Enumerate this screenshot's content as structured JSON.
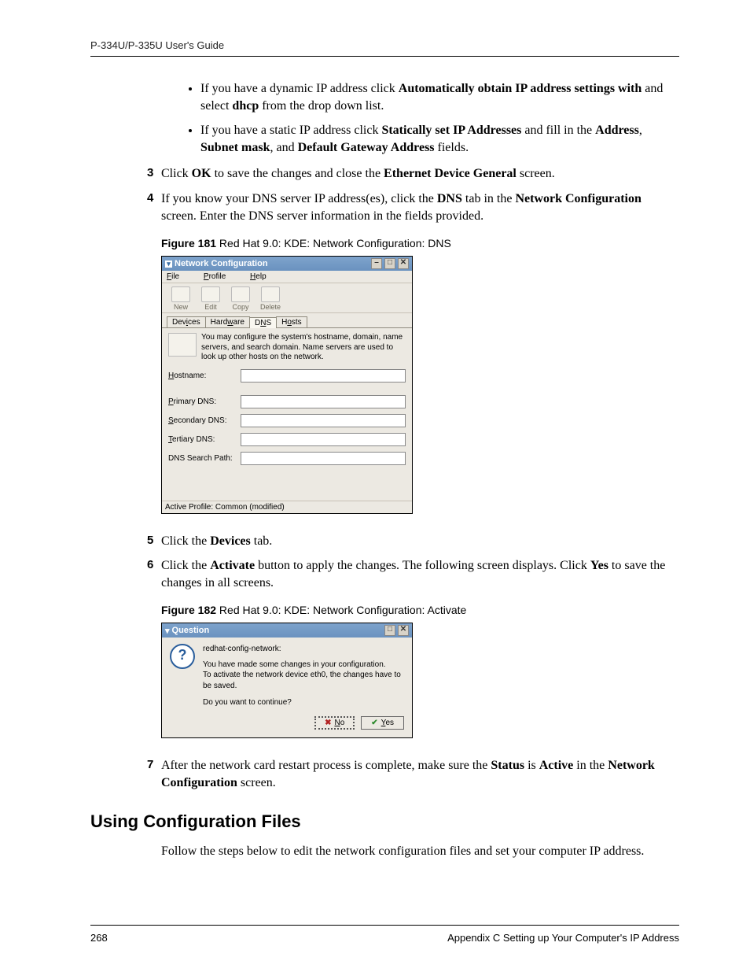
{
  "header": {
    "guide_title": "P-334U/P-335U User's Guide"
  },
  "bullets": {
    "b1_pre": "If you have a dynamic IP address click ",
    "b1_bold1": "Automatically obtain IP address settings with",
    "b1_mid": " and select ",
    "b1_bold2": "dhcp",
    "b1_post": " from the drop down list.",
    "b2_pre": "If you have a static IP address click ",
    "b2_bold1": "Statically set IP Addresses",
    "b2_mid1": " and fill in the  ",
    "b2_bold2": "Address",
    "b2_c1": ", ",
    "b2_bold3": "Subnet mask",
    "b2_c2": ", and ",
    "b2_bold4": "Default Gateway Address",
    "b2_post": " fields."
  },
  "steps": {
    "s3_num": "3",
    "s3_pre": "Click ",
    "s3_bold1": "OK",
    "s3_mid": " to save the changes and close the ",
    "s3_bold2": "Ethernet Device General",
    "s3_post": " screen.",
    "s4_num": "4",
    "s4_pre": "If you know your DNS server IP address(es), click the ",
    "s4_bold1": "DNS",
    "s4_mid": " tab in the ",
    "s4_bold2": "Network Configuration",
    "s4_post": " screen. Enter the DNS server information in the fields provided.",
    "s5_num": "5",
    "s5_pre": "Click the ",
    "s5_bold1": "Devices",
    "s5_post": " tab.",
    "s6_num": "6",
    "s6_pre": "Click the ",
    "s6_bold1": "Activate",
    "s6_mid": " button to apply the changes. The following screen displays. Click ",
    "s6_bold2": "Yes",
    "s6_post": " to save the changes in all screens.",
    "s7_num": "7",
    "s7_pre": "After the network card restart process is complete, make sure the ",
    "s7_bold1": "Status",
    "s7_mid": " is ",
    "s7_bold2": "Active",
    "s7_mid2": " in the ",
    "s7_bold3": "Network Configuration",
    "s7_post": " screen."
  },
  "fig181": {
    "label": "Figure 181",
    "caption": "   Red Hat 9.0: KDE: Network Configuration: DNS",
    "window_title": "Network Configuration",
    "menu": {
      "file": "File",
      "profile": "Profile",
      "help": "Help"
    },
    "toolbar": {
      "new": "New",
      "edit": "Edit",
      "copy": "Copy",
      "delete": "Delete"
    },
    "tabs": {
      "devices": "Devices",
      "hardware": "Hardware",
      "dns": "DNS",
      "hosts": "Hosts"
    },
    "info": "You may configure the system's hostname, domain, name servers, and search domain. Name servers are used to look up other hosts on the network.",
    "fields": {
      "hostname": "Hostname:",
      "primary": "Primary DNS:",
      "secondary": "Secondary DNS:",
      "tertiary": "Tertiary DNS:",
      "search": "DNS Search Path:"
    },
    "status": "Active Profile: Common (modified)"
  },
  "fig182": {
    "label": "Figure 182",
    "caption": "   Red Hat 9.0: KDE: Network Configuration: Activate",
    "window_title": "Question",
    "line1": "redhat-config-network:",
    "line2": "You have made some changes in your configuration.",
    "line3": "To activate the network device eth0, the changes have to be saved.",
    "line4": "Do you want to continue?",
    "btn_no": "No",
    "btn_yes": "Yes"
  },
  "heading": "Using Configuration Files",
  "para": "Follow the steps below to edit the network configuration files and set your computer IP address.",
  "footer": {
    "page": "268",
    "appendix": "Appendix C Setting up Your Computer's IP Address"
  }
}
